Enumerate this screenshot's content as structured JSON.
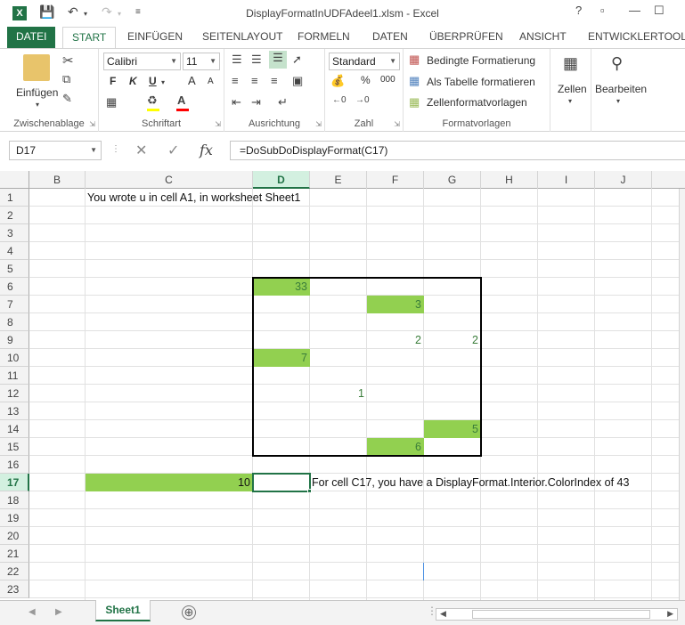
{
  "app": {
    "title": "DisplayFormatInUDFAdeel1.xlsm - Excel",
    "logo": "X"
  },
  "window_buttons": [
    "?",
    "▫",
    "—",
    "☐"
  ],
  "tabs": [
    {
      "label": "DATEI"
    },
    {
      "label": "START"
    },
    {
      "label": "EINFÜGEN"
    },
    {
      "label": "SEITENLAYOUT"
    },
    {
      "label": "FORMELN"
    },
    {
      "label": "DATEN"
    },
    {
      "label": "ÜBERPRÜFEN"
    },
    {
      "label": "ANSICHT"
    },
    {
      "label": "ENTWICKLERTOOLS"
    }
  ],
  "ribbon": {
    "clipboard": {
      "label": "Zwischenablage",
      "paste": "Einfügen"
    },
    "font": {
      "label": "Schriftart",
      "name": "Calibri",
      "size": "11",
      "bold": "F",
      "italic": "K",
      "underline": "U",
      "grow": "A",
      "shrink": "A"
    },
    "alignment": {
      "label": "Ausrichtung"
    },
    "number": {
      "label": "Zahl",
      "format": "Standard",
      "percent": "%",
      "thousands": "000"
    },
    "styles": {
      "label": "Formatvorlagen",
      "conditional": "Bedingte Formatierung",
      "as_table": "Als Tabelle formatieren",
      "cell_styles": "Zellenformatvorlagen"
    },
    "cells": {
      "label": "Zellen"
    },
    "editing": {
      "label": "Bearbeiten"
    }
  },
  "formula_bar": {
    "name_box": "D17",
    "fx": "fx",
    "formula": "=DoSubDoDisplayFormat(C17)"
  },
  "columns": [
    "B",
    "C",
    "D",
    "E",
    "F",
    "G",
    "H",
    "I",
    "J"
  ],
  "selected_column": "D",
  "rows": [
    "1",
    "2",
    "3",
    "4",
    "5",
    "6",
    "7",
    "8",
    "9",
    "10",
    "11",
    "12",
    "13",
    "14",
    "15",
    "16",
    "17",
    "18",
    "19",
    "20",
    "21",
    "22",
    "23"
  ],
  "selected_row": "17",
  "cells": {
    "C1": "You wrote u in cell A1,  in worksheet Sheet1",
    "D6": "33",
    "F7": "3",
    "F9": "2",
    "G9": "2",
    "D10": "7",
    "E12": "1",
    "G14": "5",
    "F15": "6",
    "C17": "10",
    "E17": "For cell C17, you have a DisplayFormat.Interior.ColorIndex of  43"
  },
  "colors": {
    "accent": "#217346",
    "fill_green": "#92d050"
  },
  "sheets": [
    {
      "name": "Sheet1"
    }
  ],
  "add_sheet": "⊕"
}
